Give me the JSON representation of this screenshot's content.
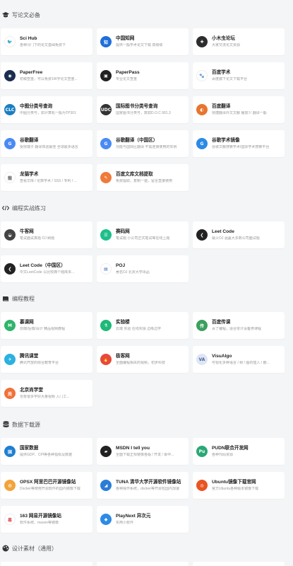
{
  "sections": [
    {
      "title": "写论文必备",
      "icon": "graduation-cap-icon",
      "items": [
        {
          "title": "Sci Hub",
          "desc": "各种冷门下的论文基础免费下",
          "color": "#ffffff",
          "glyph": "🐦",
          "fg": "#333"
        },
        {
          "title": "中国知网",
          "desc": "提供一般学术论文下载 高级级",
          "color": "#1e6fd9",
          "glyph": "知"
        },
        {
          "title": "小木虫论坛",
          "desc": "大家交流论文资源",
          "color": "#2d2d2d",
          "glyph": "✚"
        },
        {
          "title": "PaperFree",
          "desc": "初稿查重，可以免费1W字论文查重...",
          "color": "#1b2d4f",
          "glyph": "◉"
        },
        {
          "title": "PaperPass",
          "desc": "专业论文查重",
          "color": "#222222",
          "glyph": "▣"
        },
        {
          "title": "百度学术",
          "desc": "百度旗下论文下载平台",
          "color": "#ffffff",
          "glyph": "🐾",
          "fg": "#2b5fd9"
        },
        {
          "title": "中图分类号查询",
          "desc": "中图分类号，如计算机一般为TP301",
          "color": "#1a7fc1",
          "glyph": "CLC"
        },
        {
          "title": "国际图书分类号查询",
          "desc": "国家图书分类号，数如D.O.C 681.3",
          "color": "#333333",
          "glyph": "UDC"
        },
        {
          "title": "百度翻译",
          "desc": "快捷翻译外文文献 播放少 翻译一般",
          "color": "#e8752f",
          "glyph": "◐"
        },
        {
          "title": "谷歌翻译",
          "desc": "受限端子 翻译体验最佳 全球最多语言",
          "color": "#4a8af4",
          "glyph": "G"
        },
        {
          "title": "谷歌翻译（中国区）",
          "desc": "功能与国际区翻译 不需连接使用的实例",
          "color": "#4a8af4",
          "glyph": "G"
        },
        {
          "title": "谷歌学术镜像",
          "desc": "谷歌文献搜索学术/国际学术搜索平台",
          "color": "#2b8ae6",
          "glyph": "G"
        },
        {
          "title": "龙猫学术",
          "desc": "查看文库 / 论数学术 / SSS / 专利 / ...",
          "color": "#ffffff",
          "glyph": "龍",
          "fg": "#666"
        },
        {
          "title": "百度文库文档提取",
          "desc": "免费提取，复制一遍，留言直接使用",
          "color": "#f07a3a",
          "glyph": "✎"
        }
      ]
    },
    {
      "title": "编程实战练习",
      "icon": "code-icon",
      "items": [
        {
          "title": "牛客网",
          "desc": "笔试面试真题 OJ 刷题",
          "color": "#444444",
          "glyph": "◒"
        },
        {
          "title": "赛码网",
          "desc": "笔试题 小公司正式笔试等在线上题",
          "color": "#1dbf8a",
          "glyph": "☰"
        },
        {
          "title": "Leet Code",
          "desc": "最火OJ 涵盖大多数公司面试题",
          "color": "#222222",
          "glyph": "❮"
        },
        {
          "title": "Leet Code（中国区）",
          "desc": "中文LeetCode 以比较典个题库多...",
          "color": "#222222",
          "glyph": "❮"
        },
        {
          "title": "POJ",
          "desc": "著名OJ 北京大学出品",
          "color": "#ffffff",
          "glyph": "▤",
          "fg": "#3a6fc4"
        }
      ]
    },
    {
      "title": "编程教程",
      "icon": "book-icon",
      "items": [
        {
          "title": "慕课网",
          "desc": "前端/后端/设计 精品视频教程",
          "color": "#2fb56a",
          "glyph": "M"
        },
        {
          "title": "实验楼",
          "desc": "云端 实验 在线实操 边练边学",
          "color": "#1db978",
          "glyph": "⚗"
        },
        {
          "title": "百度传课",
          "desc": "百了编程，适合零计设备类课程",
          "color": "#3aa05e",
          "glyph": "传"
        },
        {
          "title": "腾讯课堂",
          "desc": "腾讯开放的综合教育平台",
          "color": "#2bb1e0",
          "glyph": "✈"
        },
        {
          "title": "极客网",
          "desc": "全面编程相关的视频，初步科技",
          "color": "#e8493a",
          "glyph": "🔥"
        },
        {
          "title": "VisuAlgo",
          "desc": "可视化多种语言 / 树 / 图的插入 / 删...",
          "color": "#dfe6f3",
          "glyph": "VA",
          "fg": "#4a63a3"
        },
        {
          "title": "北京尚学堂",
          "desc": "也有很多学好大量视频 入门工...",
          "color": "#f0723a",
          "glyph": "尚"
        }
      ]
    },
    {
      "title": "数据下载源",
      "icon": "database-icon",
      "items": [
        {
          "title": "国家数据",
          "desc": "提供GDP、CPI等各种指标及数据",
          "color": "#1f7fd0",
          "glyph": "国"
        },
        {
          "title": "MSDN I tell you",
          "desc": "全面下载正规镜像各版 / 开发 / 即中...",
          "color": "#222222",
          "glyph": "▰"
        },
        {
          "title": "PUDN联合开发网",
          "desc": "各种代码资源",
          "color": "#2aa876",
          "glyph": "Pu"
        },
        {
          "title": "OPSX 阿里巴巴开源镜像站",
          "desc": "Docker等使用开源软件的国内镜像下载",
          "color": "#f2a43a",
          "glyph": "◍"
        },
        {
          "title": "TUNA 清华大学开源软件镜像站",
          "desc": "各种操作系统，docker等开源包国内加速",
          "color": "#2a7dd6",
          "glyph": "◢"
        },
        {
          "title": "Ubuntu镜像下载官网",
          "desc": "官方Ubuntu各种版本镜像下载",
          "color": "#e95420",
          "glyph": "◎"
        },
        {
          "title": "163 网易开源镜像站",
          "desc": "软件系统、maven等镜像",
          "color": "#ffffff",
          "glyph": "易",
          "fg": "#d8343a"
        },
        {
          "title": "PlayNext 异次元",
          "desc": "实用小软件",
          "color": "#2d8be6",
          "glyph": "◆"
        }
      ]
    },
    {
      "title": "设计素材（通用）",
      "icon": "palette-icon",
      "items": []
    }
  ]
}
